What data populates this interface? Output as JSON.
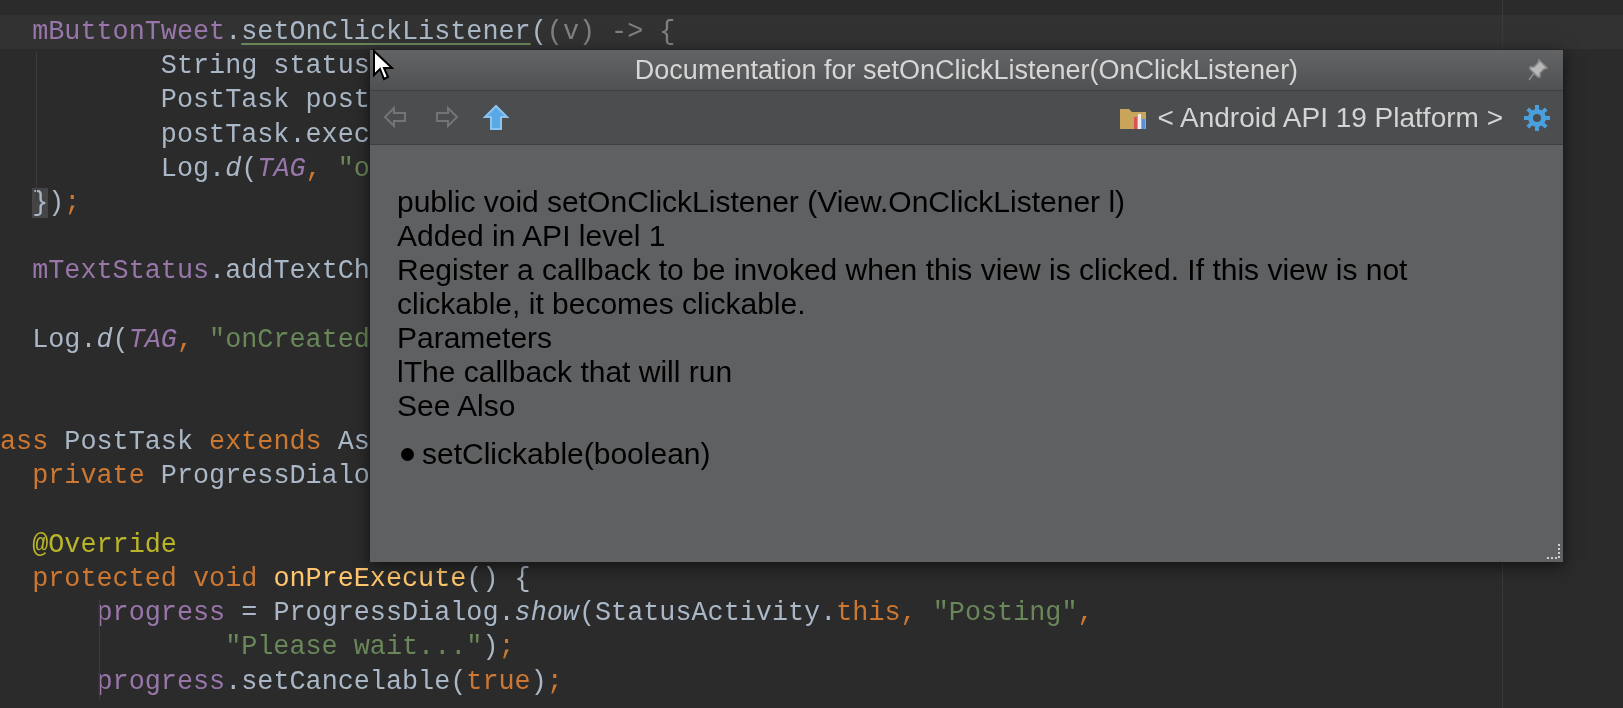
{
  "editor": {
    "lines": [
      {
        "kind": "code",
        "current": true,
        "tokens": [
          {
            "kind": "field",
            "text": "  mButtonTweet"
          },
          {
            "kind": "plain",
            "text": "."
          },
          {
            "kind": "link",
            "text": "setOnClickListener"
          },
          {
            "kind": "plain",
            "text": "("
          },
          {
            "kind": "dim",
            "text": "(v) -> {"
          }
        ]
      },
      {
        "kind": "code",
        "current": false,
        "tokens": [
          {
            "kind": "plain",
            "text": "          String status"
          }
        ]
      },
      {
        "kind": "code",
        "current": false,
        "tokens": [
          {
            "kind": "plain",
            "text": "          PostTask post"
          }
        ]
      },
      {
        "kind": "code",
        "current": false,
        "tokens": [
          {
            "kind": "plain",
            "text": "          postTask.exec"
          }
        ]
      },
      {
        "kind": "code",
        "current": false,
        "tokens": [
          {
            "kind": "plain",
            "text": "          Log."
          },
          {
            "kind": "static",
            "text": "d"
          },
          {
            "kind": "plain",
            "text": "("
          },
          {
            "kind": "constant",
            "text": "TAG"
          },
          {
            "kind": "keyword",
            "text": ", "
          },
          {
            "kind": "string",
            "text": "\"o"
          }
        ]
      },
      {
        "kind": "code",
        "current": false,
        "tokens": [
          {
            "kind": "brace",
            "text": "  }"
          },
          {
            "kind": "plain",
            "text": ")"
          },
          {
            "kind": "keyword",
            "text": ";"
          }
        ]
      },
      {
        "kind": "blank"
      },
      {
        "kind": "code",
        "current": false,
        "tokens": [
          {
            "kind": "field",
            "text": "  mTextStatus"
          },
          {
            "kind": "plain",
            "text": ".addTextCh"
          }
        ]
      },
      {
        "kind": "blank"
      },
      {
        "kind": "code",
        "current": false,
        "tokens": [
          {
            "kind": "plain",
            "text": "  Log."
          },
          {
            "kind": "static",
            "text": "d"
          },
          {
            "kind": "plain",
            "text": "("
          },
          {
            "kind": "constant",
            "text": "TAG"
          },
          {
            "kind": "keyword",
            "text": ", "
          },
          {
            "kind": "string",
            "text": "\"onCreated"
          }
        ]
      },
      {
        "kind": "blank"
      },
      {
        "kind": "blank"
      },
      {
        "kind": "code",
        "current": false,
        "tokens": [
          {
            "kind": "keyword",
            "text": "ass "
          },
          {
            "kind": "plain",
            "text": "PostTask "
          },
          {
            "kind": "keyword",
            "text": "extends "
          },
          {
            "kind": "plain",
            "text": "As"
          }
        ]
      },
      {
        "kind": "code",
        "current": false,
        "tokens": [
          {
            "kind": "keyword",
            "text": "  private "
          },
          {
            "kind": "plain",
            "text": "ProgressDialo"
          }
        ]
      },
      {
        "kind": "blank"
      },
      {
        "kind": "code",
        "current": false,
        "tokens": [
          {
            "kind": "annotation",
            "text": "  @Override"
          }
        ]
      },
      {
        "kind": "code",
        "current": false,
        "tokens": [
          {
            "kind": "keyword",
            "text": "  protected void "
          },
          {
            "kind": "decl",
            "text": "onPreExecute"
          },
          {
            "kind": "plain",
            "text": "() {"
          }
        ]
      },
      {
        "kind": "code",
        "current": false,
        "tokens": [
          {
            "kind": "field",
            "text": "      progress"
          },
          {
            "kind": "plain",
            "text": " = ProgressDialog."
          },
          {
            "kind": "static",
            "text": "show"
          },
          {
            "kind": "plain",
            "text": "(StatusActivity."
          },
          {
            "kind": "keyword",
            "text": "this, "
          },
          {
            "kind": "string",
            "text": "\"Posting\""
          },
          {
            "kind": "keyword",
            "text": ","
          }
        ]
      },
      {
        "kind": "code",
        "current": false,
        "tokens": [
          {
            "kind": "string",
            "text": "              \"Please wait...\""
          },
          {
            "kind": "plain",
            "text": ")"
          },
          {
            "kind": "keyword",
            "text": ";"
          }
        ]
      },
      {
        "kind": "code",
        "current": false,
        "tokens": [
          {
            "kind": "field",
            "text": "      progress"
          },
          {
            "kind": "plain",
            "text": ".setCancelable("
          },
          {
            "kind": "keyword",
            "text": "true"
          },
          {
            "kind": "plain",
            "text": ")"
          },
          {
            "kind": "keyword",
            "text": ";"
          }
        ]
      }
    ]
  },
  "popup": {
    "title": "Documentation for setOnClickListener(OnClickListener)",
    "nav": [
      {
        "kind": "back",
        "disabled": true
      },
      {
        "kind": "forward",
        "disabled": true
      },
      {
        "kind": "up",
        "disabled": false
      }
    ],
    "location": "< Android API 19 Platform >",
    "doc": {
      "signature": "public void setOnClickListener (View.OnClickListener l)",
      "added": "Added in API level 1",
      "description": "Register a callback to be invoked when this view is clicked. If this view is not clickable, it becomes clickable.",
      "sections": [
        {
          "heading": "Parameters",
          "items": [
            {
              "kind": "param",
              "text": "lThe callback that will run"
            }
          ]
        },
        {
          "heading": "See Also",
          "items": [
            {
              "kind": "link",
              "text": "setClickable(boolean)"
            }
          ]
        }
      ]
    }
  }
}
